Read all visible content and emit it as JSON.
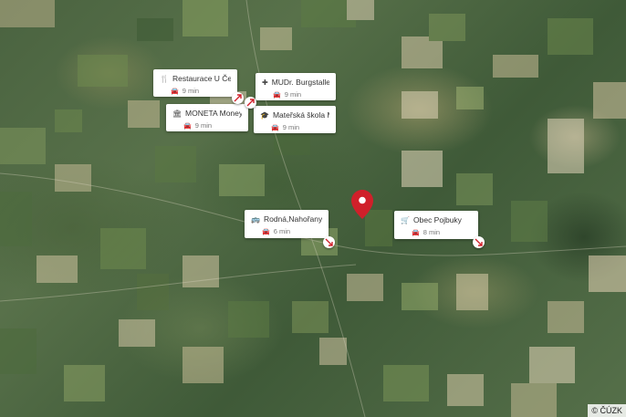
{
  "map": {
    "copyright": "© ČÚZK",
    "pin_color": "#d0202a"
  },
  "pois": [
    {
      "icon": "restaurant-icon",
      "glyph": "🍴",
      "title": "Restaurace U Čes…",
      "time": "9 min"
    },
    {
      "icon": "medical-icon",
      "glyph": "✚",
      "title": "MUDr. Burgstaller…",
      "time": "9 min"
    },
    {
      "icon": "bank-icon",
      "glyph": "🏛",
      "title": "MONETA Money …",
      "time": "9 min"
    },
    {
      "icon": "school-icon",
      "glyph": "🎓",
      "title": "Mateřská škola M…",
      "time": "9 min"
    },
    {
      "icon": "bus-icon",
      "glyph": "🚌",
      "title": "Rodná,Nahořany,…",
      "time": "6 min"
    },
    {
      "icon": "shop-icon",
      "glyph": "🛒",
      "title": "Obec Pojbuky",
      "time": "8 min"
    }
  ]
}
